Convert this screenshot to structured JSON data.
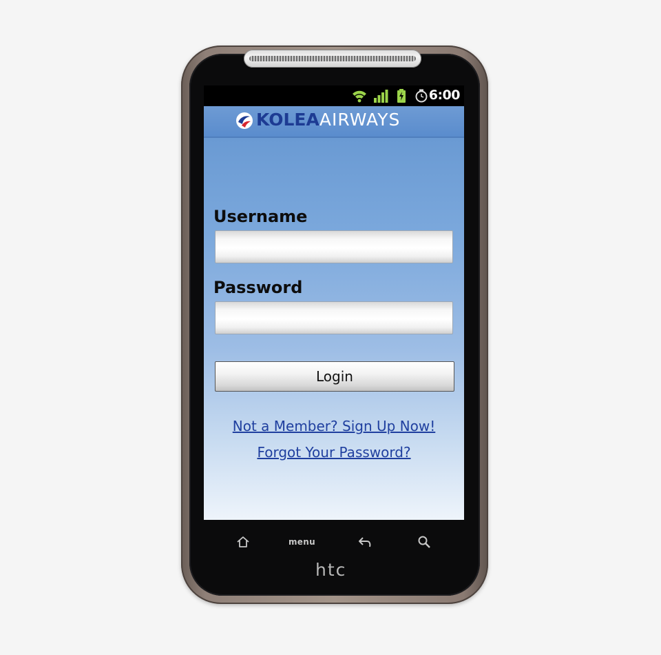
{
  "status_bar": {
    "time": "6:00",
    "icons": [
      "wifi-icon",
      "signal-icon",
      "battery-charging-icon",
      "alarm-icon"
    ],
    "accent_color": "#9bd34a"
  },
  "header": {
    "logo_icon": "airline-logo-icon",
    "logo_primary": "KOLEA",
    "logo_secondary": "AIRWAYS",
    "logo_primary_color": "#1d3b93"
  },
  "login_form": {
    "username_label": "Username",
    "username_value": "",
    "password_label": "Password",
    "password_value": "",
    "login_button": "Login"
  },
  "links": {
    "signup": "Not a Member? Sign Up Now!",
    "forgot_password": "Forgot Your Password?",
    "link_color": "#1f3f9f"
  },
  "hardware_keys": {
    "home": "home-icon",
    "menu": "menu",
    "back": "back-icon",
    "search": "search-icon"
  },
  "device": {
    "brand": "htc"
  }
}
